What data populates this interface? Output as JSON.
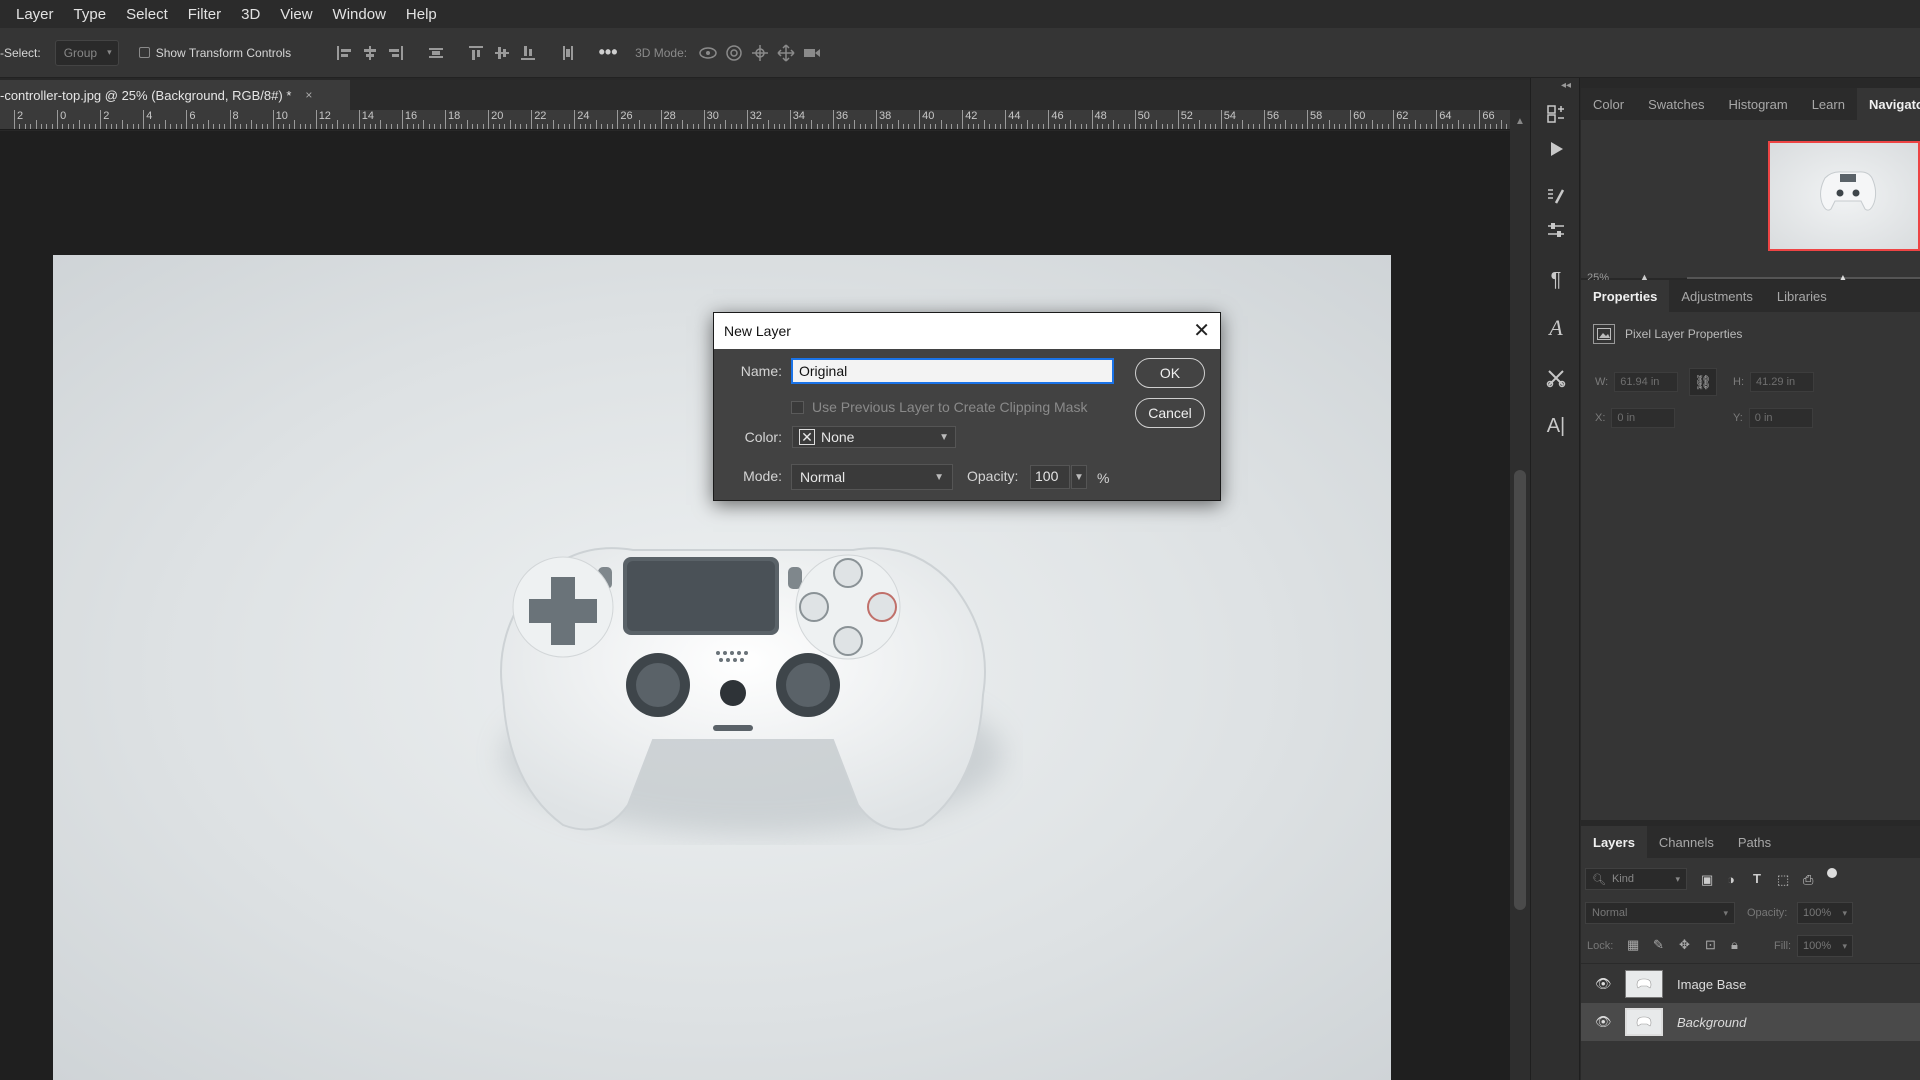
{
  "menu": [
    "Layer",
    "Type",
    "Select",
    "Filter",
    "3D",
    "View",
    "Window",
    "Help"
  ],
  "options": {
    "auto_select_label": "-Select:",
    "group_value": "Group",
    "transform_label": "Show Transform Controls",
    "mode3d_label": "3D Mode:"
  },
  "doc_tab": {
    "title": "-controller-top.jpg @ 25% (Background, RGB/8#) *",
    "close": "×"
  },
  "ruler_labels": [
    "2",
    "0",
    "2",
    "4",
    "6",
    "8",
    "10",
    "12",
    "14",
    "16",
    "18",
    "20",
    "22",
    "24",
    "26",
    "28",
    "30",
    "32",
    "34",
    "36",
    "38",
    "40",
    "42",
    "44",
    "46",
    "48",
    "50",
    "52",
    "54",
    "56",
    "58",
    "60",
    "62",
    "64",
    "66"
  ],
  "dialog": {
    "title": "New Layer",
    "name_label": "Name:",
    "name_value": "Original",
    "clip_label": "Use Previous Layer to Create Clipping Mask",
    "color_label": "Color:",
    "color_value": "None",
    "mode_label": "Mode:",
    "mode_value": "Normal",
    "opacity_label": "Opacity:",
    "opacity_value": "100",
    "percent": "%",
    "ok": "OK",
    "cancel": "Cancel"
  },
  "top_panel": {
    "tabs": [
      "Color",
      "Swatches",
      "Histogram",
      "Learn",
      "Navigator"
    ],
    "active_tab": "Navigator",
    "zoom": "25%"
  },
  "properties": {
    "tabs": [
      "Properties",
      "Adjustments",
      "Libraries"
    ],
    "active_tab": "Properties",
    "header": "Pixel Layer Properties",
    "w_label": "W:",
    "w_value": "61.94 in",
    "h_label": "H:",
    "h_value": "41.29 in",
    "x_label": "X:",
    "x_value": "0 in",
    "y_label": "Y:",
    "y_value": "0 in"
  },
  "layers": {
    "tabs": [
      "Layers",
      "Channels",
      "Paths"
    ],
    "active_tab": "Layers",
    "kind_placeholder": "Kind",
    "blend_mode": "Normal",
    "opacity_label": "Opacity:",
    "opacity_value": "100%",
    "lock_label": "Lock:",
    "fill_label": "Fill:",
    "fill_value": "100%",
    "items": [
      {
        "name": "Image Base",
        "selected": false
      },
      {
        "name": "Background",
        "selected": true
      }
    ]
  },
  "colors": {
    "accent_blue": "#1a73e8",
    "navigator_frame": "#ee4444"
  }
}
